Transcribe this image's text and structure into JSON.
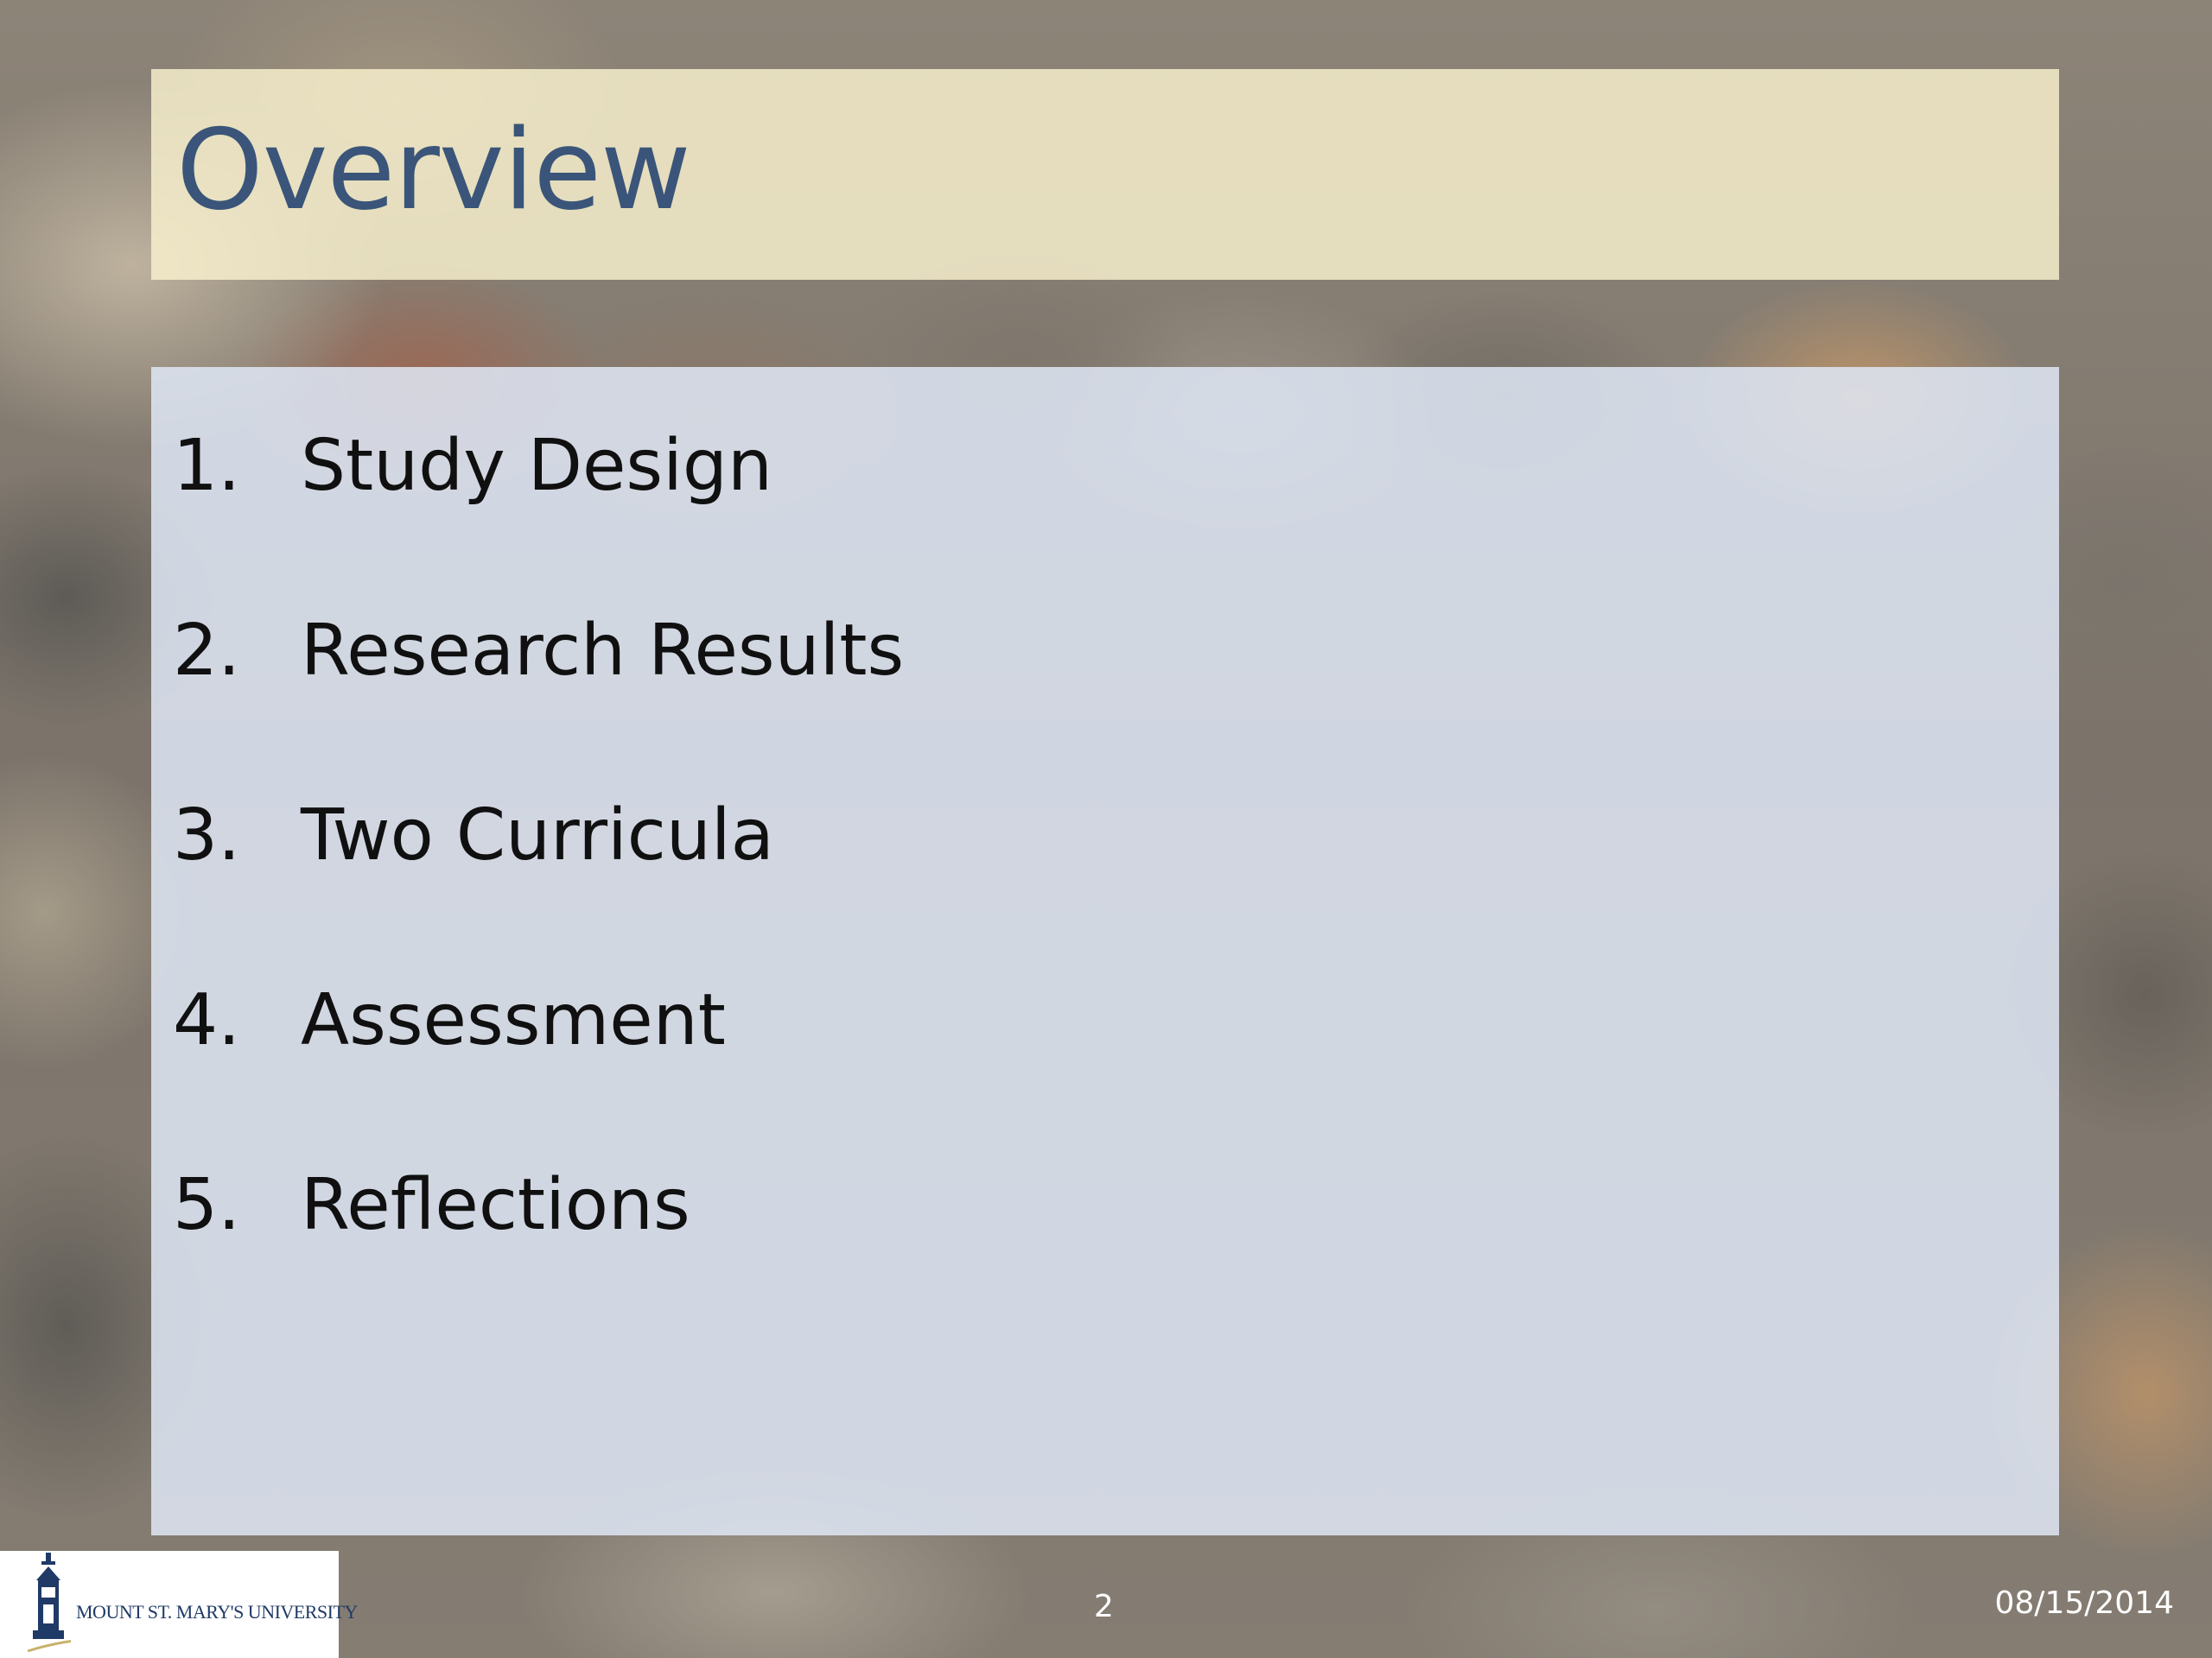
{
  "slide": {
    "title": "Overview",
    "agenda": [
      {
        "number": "1.",
        "label": "Study Design"
      },
      {
        "number": "2.",
        "label": "Research Results"
      },
      {
        "number": "3.",
        "label": "Two Curricula"
      },
      {
        "number": "4.",
        "label": "Assessment"
      },
      {
        "number": "5.",
        "label": "Reflections"
      }
    ],
    "footer": {
      "logo_text": "MOUNT ST. MARY'S UNIVERSITY",
      "page_number": "2",
      "date": "08/15/2014"
    }
  },
  "colors": {
    "title": "#3a5579",
    "title_box": "#f9f2ce",
    "content_box": "#dee6f4",
    "logo": "#1f3a66"
  },
  "icons": {
    "logo": "university-tower-logo-icon"
  }
}
